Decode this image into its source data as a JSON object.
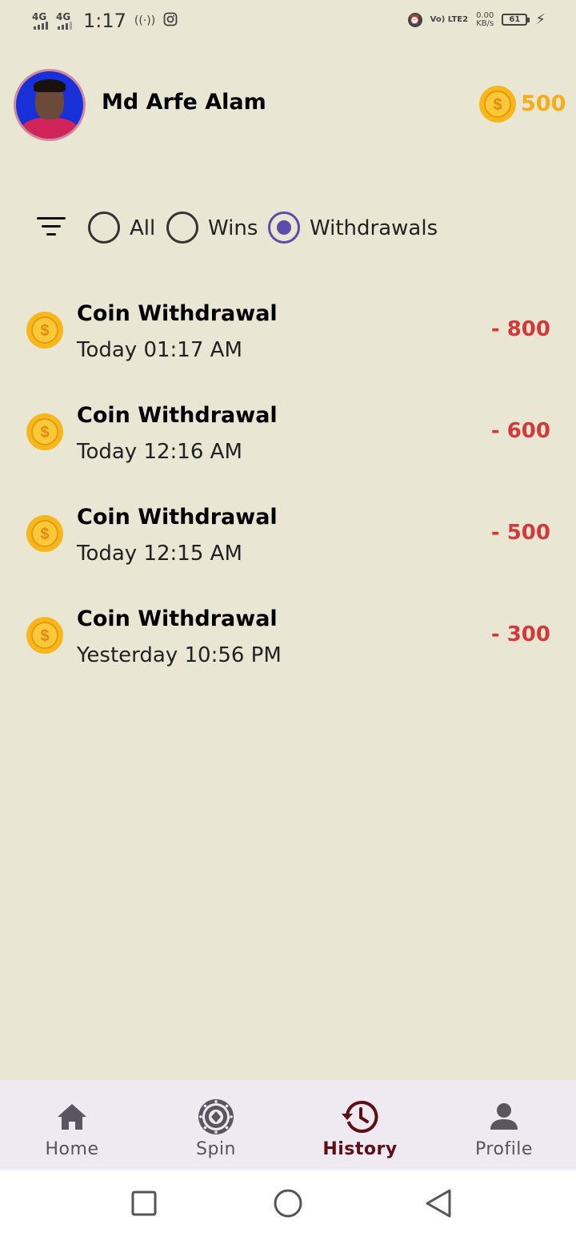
{
  "status_bar": {
    "net1": "4G",
    "net2": "4G",
    "time": "1:17",
    "hotspot": "((·))",
    "volte": "Vo) LTE2",
    "speed_value": "0.00",
    "speed_unit": "KB/s",
    "battery": "61"
  },
  "header": {
    "username": "Md Arfe Alam",
    "balance": "500",
    "coin_color": "#f7b71a"
  },
  "filters": {
    "options": [
      {
        "label": "All",
        "selected": false
      },
      {
        "label": "Wins",
        "selected": false
      },
      {
        "label": "Withdrawals",
        "selected": true
      }
    ],
    "accent": "#5b4da8"
  },
  "transactions": [
    {
      "title": "Coin Withdrawal",
      "time": "Today 01:17 AM",
      "amount": "- 800"
    },
    {
      "title": "Coin Withdrawal",
      "time": "Today 12:16 AM",
      "amount": "- 600"
    },
    {
      "title": "Coin Withdrawal",
      "time": "Today 12:15 AM",
      "amount": "- 500"
    },
    {
      "title": "Coin Withdrawal",
      "time": "Yesterday 10:56 PM",
      "amount": "- 300"
    }
  ],
  "bottom_nav": {
    "items": [
      {
        "label": "Home",
        "icon": "home-icon",
        "active": false
      },
      {
        "label": "Spin",
        "icon": "spin-wheel-icon",
        "active": false
      },
      {
        "label": "History",
        "icon": "history-icon",
        "active": true
      },
      {
        "label": "Profile",
        "icon": "person-icon",
        "active": false
      }
    ],
    "active_color": "#5e0f14"
  },
  "system_nav": {
    "icons": [
      "recent-apps-icon",
      "home-circle-icon",
      "back-triangle-icon"
    ]
  }
}
